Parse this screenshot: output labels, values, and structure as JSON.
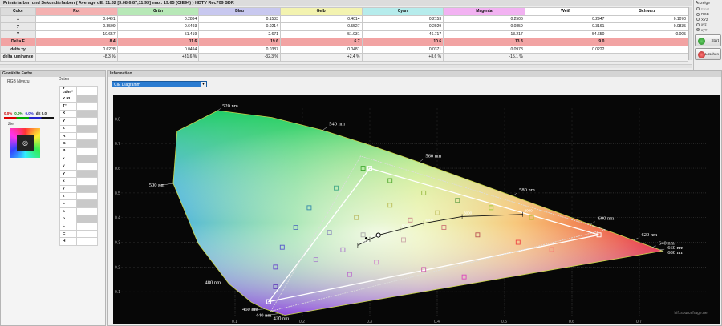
{
  "window": {
    "title": "Primärfarben und Sekundärfarben ( Average dE: 11.32 [3.08,6.87,11.93] max: 19.65 (CIE94) ) HDTV Rec709  SDR"
  },
  "table": {
    "columns": [
      "Color",
      "Rot",
      "Grün",
      "Blau",
      "Gelb",
      "Cyan",
      "Magenta",
      "Weiß",
      "Schwarz"
    ],
    "header_colors": [
      "#dcdcdc",
      "#f4b1b1",
      "#b7e8b7",
      "#c8c8ef",
      "#f3f3b0",
      "#b6ecec",
      "#f2b2f2",
      "#ffffff",
      "#ffffff"
    ],
    "rows": [
      {
        "label": "x",
        "cls": "",
        "values": [
          "0.6491",
          "0.2864",
          "0.1533",
          "0.4014",
          "0.2153",
          "0.2506",
          "0.2947",
          "0.1070"
        ]
      },
      {
        "label": "y",
        "cls": "",
        "values": [
          "0.3509",
          "0.6493",
          "0.0214",
          "0.5527",
          "0.2929",
          "0.0859",
          "0.3161",
          "0.0835"
        ]
      },
      {
        "label": "Y",
        "cls": "",
        "values": [
          "10.657",
          "51.419",
          "2.671",
          "51.931",
          "46.717",
          "13.217",
          "54.650",
          "0.005"
        ]
      },
      {
        "label": "Delta E",
        "cls": "de",
        "values": [
          "8.4",
          "11.6",
          "19.6",
          "6.7",
          "10.6",
          "13.3",
          "9.0",
          ""
        ]
      },
      {
        "label": "delta xy",
        "cls": "",
        "values": [
          "0.0228",
          "0.0494",
          "0.0387",
          "0.0481",
          "0.0371",
          "0.0978",
          "0.0222",
          ""
        ]
      },
      {
        "label": "delta luminance",
        "cls": "dx",
        "values": [
          "-8.3 %",
          "+31.6 %",
          "-32.3 %",
          "+2.4 %",
          "+8.6 %",
          "-15.1 %",
          "",
          ""
        ]
      }
    ]
  },
  "anzeige": {
    "title": "Anzeige",
    "options": [
      {
        "label": "Einst.",
        "state": "dim"
      },
      {
        "label": "RGB",
        "state": ""
      },
      {
        "label": "XYZ",
        "state": ""
      },
      {
        "label": "xyz",
        "state": ""
      },
      {
        "label": "xyY",
        "state": "on"
      }
    ],
    "start_label": "Start",
    "loeschen_label": "Löschen"
  },
  "left": {
    "panel_title": "Gewählte Farbe",
    "rgb_label": "RGB Nivezu",
    "values": [
      "0.0%",
      "0.0%",
      "0.0%",
      "dE 0.0"
    ],
    "ziel_label": "Ziel",
    "daten_label": "Daten",
    "fields": [
      "Y cd/m²",
      "Y RL",
      "T°",
      "X",
      "Y",
      "Z",
      "R",
      "G",
      "B",
      "x",
      "y",
      "Y",
      "x",
      "y",
      "z",
      "L",
      "a",
      "b",
      "L",
      "C",
      "H"
    ]
  },
  "info": {
    "panel_title": "Information",
    "dropdown_value": "CIE Diagramm",
    "watermark": "hifi.sourcefrage.net"
  },
  "chart_data": {
    "type": "scatter",
    "title": "",
    "x_ticks": [
      "0.1",
      "0.2",
      "0.3",
      "0.4",
      "0.5",
      "0.6",
      "0.7"
    ],
    "y_ticks": [
      "0.1",
      "0.2",
      "0.3",
      "0.4",
      "0.5",
      "0.6",
      "0.7",
      "0.8"
    ],
    "xlim": [
      0.0,
      0.8
    ],
    "ylim": [
      0.0,
      0.85
    ],
    "spectral_labels": [
      {
        "nm": "520 nm",
        "x": 0.074,
        "y": 0.834
      },
      {
        "nm": "540 nm",
        "x": 0.23,
        "y": 0.754
      },
      {
        "nm": "560 nm",
        "x": 0.373,
        "y": 0.624
      },
      {
        "nm": "580 nm",
        "x": 0.512,
        "y": 0.487
      },
      {
        "nm": "600 nm",
        "x": 0.627,
        "y": 0.372
      },
      {
        "nm": "620 nm",
        "x": 0.691,
        "y": 0.308
      },
      {
        "nm": "640 nm",
        "x": 0.719,
        "y": 0.28
      },
      {
        "nm": "680 nm",
        "x": 0.73,
        "y": 0.27
      },
      {
        "nm": "660 nm",
        "x": 0.73,
        "y": 0.27
      },
      {
        "nm": "500 nm",
        "x": 0.008,
        "y": 0.538
      },
      {
        "nm": "480 nm",
        "x": 0.091,
        "y": 0.132
      },
      {
        "nm": "460 nm",
        "x": 0.144,
        "y": 0.03
      },
      {
        "nm": "440 nm",
        "x": 0.164,
        "y": 0.011
      },
      {
        "nm": "420 nm",
        "x": 0.171,
        "y": 0.005
      }
    ],
    "target_gamut": [
      [
        0.64,
        0.33
      ],
      [
        0.3,
        0.6
      ],
      [
        0.15,
        0.06
      ]
    ],
    "measured_gamut": [
      [
        0.6491,
        0.3509
      ],
      [
        0.2864,
        0.6493
      ],
      [
        0.1533,
        0.0214
      ]
    ],
    "white_point": [
      0.3127,
      0.329
    ],
    "measured_white": [
      0.2947,
      0.3161
    ],
    "planck": {
      "points": [
        [
          0.527,
          0.413
        ],
        [
          0.437,
          0.404
        ],
        [
          0.38,
          0.377
        ],
        [
          0.345,
          0.352
        ],
        [
          0.313,
          0.329
        ],
        [
          0.3,
          0.312
        ],
        [
          0.282,
          0.288
        ]
      ],
      "labels": [
        "2000",
        "3000",
        "4000",
        "5000",
        "6500",
        "8000",
        "10000"
      ]
    },
    "measured_points": [
      [
        0.6,
        0.37
      ],
      [
        0.54,
        0.4
      ],
      [
        0.48,
        0.44
      ],
      [
        0.43,
        0.47
      ],
      [
        0.38,
        0.5
      ],
      [
        0.33,
        0.55
      ],
      [
        0.29,
        0.6
      ],
      [
        0.36,
        0.39
      ],
      [
        0.41,
        0.36
      ],
      [
        0.46,
        0.33
      ],
      [
        0.52,
        0.3
      ],
      [
        0.57,
        0.27
      ],
      [
        0.25,
        0.52
      ],
      [
        0.21,
        0.44
      ],
      [
        0.19,
        0.36
      ],
      [
        0.17,
        0.28
      ],
      [
        0.16,
        0.2
      ],
      [
        0.16,
        0.12
      ],
      [
        0.26,
        0.27
      ],
      [
        0.31,
        0.22
      ],
      [
        0.38,
        0.19
      ],
      [
        0.44,
        0.16
      ],
      [
        0.28,
        0.4
      ],
      [
        0.33,
        0.45
      ],
      [
        0.4,
        0.42
      ],
      [
        0.24,
        0.34
      ],
      [
        0.29,
        0.33
      ],
      [
        0.35,
        0.31
      ],
      [
        0.22,
        0.23
      ],
      [
        0.27,
        0.17
      ]
    ],
    "sample_colors": [
      "#d33",
      "#bb3",
      "#9c3",
      "#7a5",
      "#9b4",
      "#5a3",
      "#4a3",
      "#c88",
      "#c77",
      "#b55",
      "#e44",
      "#f35",
      "#4a8",
      "#38a",
      "#57b",
      "#55c",
      "#64c",
      "#64b",
      "#a7c",
      "#c6c",
      "#c5a",
      "#d4b",
      "#bb6",
      "#bb5",
      "#cc7",
      "#88b",
      "#aaa",
      "#caa",
      "#a8c",
      "#b6c"
    ]
  }
}
